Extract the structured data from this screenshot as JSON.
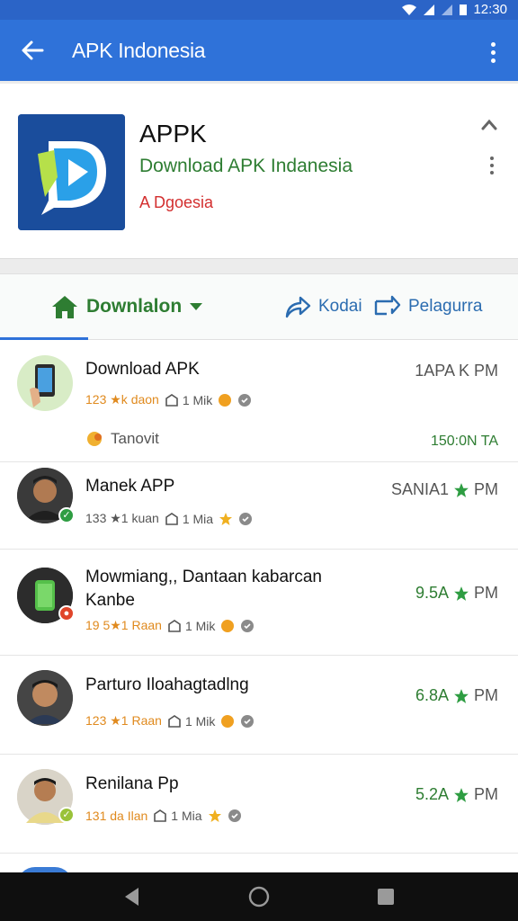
{
  "status_bar": {
    "time": "12:30"
  },
  "app_bar": {
    "title": "APK Indonesia"
  },
  "app_card": {
    "name": "APPK",
    "subtitle": "Download APK Indanesia",
    "developer": "A Dgoesia"
  },
  "tabs": {
    "downloads": "Downlalon",
    "kodai": "Kodai",
    "pelagurra": "Pelagurra"
  },
  "items": [
    {
      "title": "Download APK",
      "downloads": "123 ★k daon",
      "size": "1 Mik",
      "right": "1APA K PM",
      "sub_label": "Tanovit",
      "sub_right": "150:0N TA"
    },
    {
      "title": "Manek APP",
      "downloads": "133 ★1 kuan",
      "size": "1 Mia",
      "right": "SANIA1",
      "right_suffix": "PM"
    },
    {
      "title": "Mowmiang,, Dantaan kabarcan Kanbe",
      "downloads": "19 5★1 Raan",
      "size": "1 Mik",
      "right": "9.5A",
      "right_suffix": "PM"
    },
    {
      "title": "Parturo Iloahagtadlng",
      "downloads": "123 ★1 Raan",
      "size": "1 Mik",
      "right": "6.8A",
      "right_suffix": "PM"
    },
    {
      "title": "Renilana Pp",
      "downloads": "131 da Ilan",
      "size": "1 Mia",
      "right": "5.2A",
      "right_suffix": "PM"
    }
  ],
  "colors": {
    "app_bar": "#2f72d9",
    "status_bar": "#2b64c7",
    "accent_green": "#2e7d32",
    "accent_blue": "#2b6cb0",
    "download_orange": "#e08a1e"
  }
}
